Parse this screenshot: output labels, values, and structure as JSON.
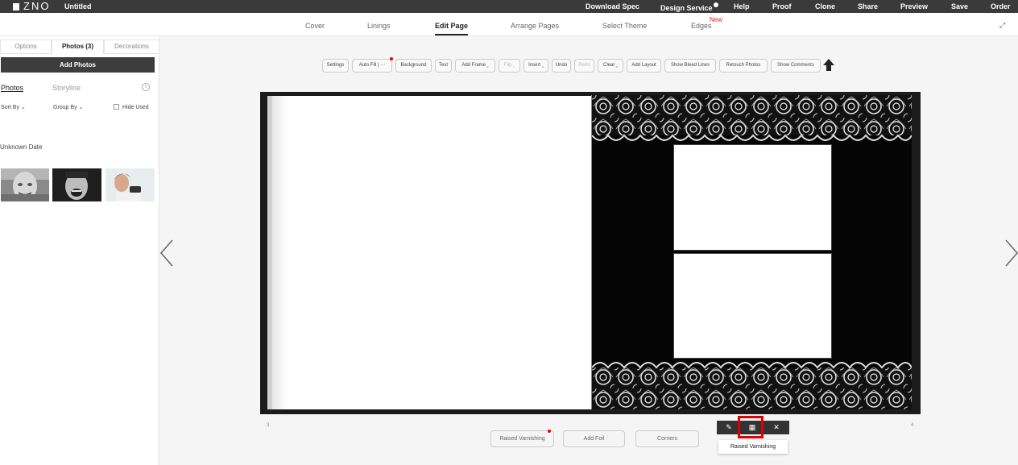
{
  "app": {
    "logo_text": "ZNO",
    "project_title": "Untitled"
  },
  "top_menu": [
    "Download Spec",
    "Design Service",
    "Help",
    "Proof",
    "Clone",
    "Share",
    "Preview",
    "Save",
    "Order"
  ],
  "tabs": {
    "items": [
      "Cover",
      "Linings",
      "Edit Page",
      "Arrange Pages",
      "Select Theme",
      "Edges"
    ],
    "active": "Edit Page",
    "new_badge": "New"
  },
  "sidebar": {
    "tabs": [
      "Options",
      "Photos (3)",
      "Decorations"
    ],
    "active_tab": "Photos (3)",
    "add_photos_label": "Add Photos",
    "photo_tabs": [
      "Photos",
      "Storyline"
    ],
    "info_icon": "i",
    "sort_by": "Sort By",
    "group_by": "Group By",
    "hide_used": "Hide Used",
    "group_label": "Unknown Date"
  },
  "toolbar": [
    "Settings",
    "Auto Fill | ···",
    "Background",
    "Text",
    "Add Frame ˬ",
    "Flip ˬ",
    "Insert ˬ",
    "Undo",
    "Redo",
    "Clear ˬ",
    "Add Layout",
    "Show Bleed Lines",
    "Retouch Photos",
    "Show Comments"
  ],
  "page_numbers": {
    "left": "3",
    "right": "4"
  },
  "bottom_buttons": [
    "Raised Varnishing",
    "Add Foil",
    "Corners"
  ],
  "tooltip": "Raised Varnishing",
  "colors": {
    "topbar": "#3a3a3a",
    "highlight": "#e00000",
    "accent_red": "#e02020"
  }
}
